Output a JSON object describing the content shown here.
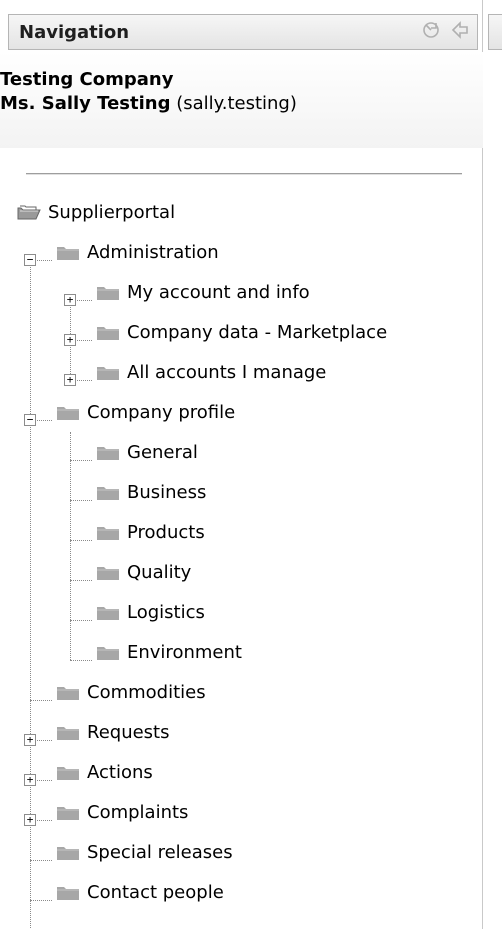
{
  "header": {
    "title": "Navigation",
    "icons": [
      "refresh-icon",
      "back-arrow-icon"
    ]
  },
  "user": {
    "company": "Testing Company",
    "name": "Ms. Sally Testing",
    "username": "(sally.testing)"
  },
  "tree": {
    "root": "Supplierportal",
    "administration": {
      "label": "Administration",
      "toggle": "−",
      "children": [
        "My account and info",
        "Company data - Marketplace",
        "All accounts I manage"
      ]
    },
    "company_profile": {
      "label": "Company profile",
      "toggle": "−",
      "children": [
        "General",
        "Business",
        "Products",
        "Quality",
        "Logistics",
        "Environment"
      ]
    },
    "others": [
      "Commodities",
      "Requests",
      "Actions",
      "Complaints",
      "Special releases",
      "Contact people"
    ],
    "collapsed_toggle": "+"
  },
  "colors": {
    "folder": "#a7a7a7",
    "header_bg": "#ececec",
    "border": "#b5b5b5"
  }
}
